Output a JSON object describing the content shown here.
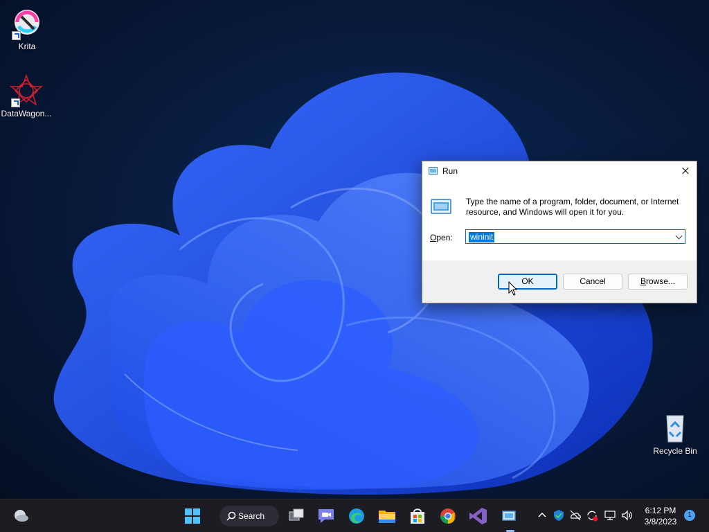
{
  "desktop": {
    "icons": [
      {
        "label": "Krita"
      },
      {
        "label": "DataWagon..."
      },
      {
        "label": "Recycle Bin"
      }
    ]
  },
  "run_dialog": {
    "title": "Run",
    "description": "Type the name of a program, folder, document, or Internet resource, and Windows will open it for you.",
    "open_label_underlined": "O",
    "open_label_rest": "pen:",
    "input_value": "wininit",
    "ok_label": "OK",
    "cancel_label": "Cancel",
    "browse_label_underlined": "B",
    "browse_label_rest": "rowse..."
  },
  "taskbar": {
    "search_label": "Search",
    "apps": [
      "windows-start-icon",
      "task-view-icon",
      "teams-chat-icon",
      "edge-icon",
      "file-explorer-icon",
      "microsoft-store-icon",
      "chrome-icon",
      "visual-studio-icon",
      "run-dialog-icon"
    ],
    "active_app": "run-dialog-icon",
    "clock_time": "6:12 PM",
    "clock_date": "3/8/2023",
    "notification_count": "1"
  },
  "colors": {
    "accent": "#0067c0",
    "selection": "#0078d7",
    "taskbar": "#1c1c22",
    "wallpaper_blue": "#2b5cff"
  }
}
